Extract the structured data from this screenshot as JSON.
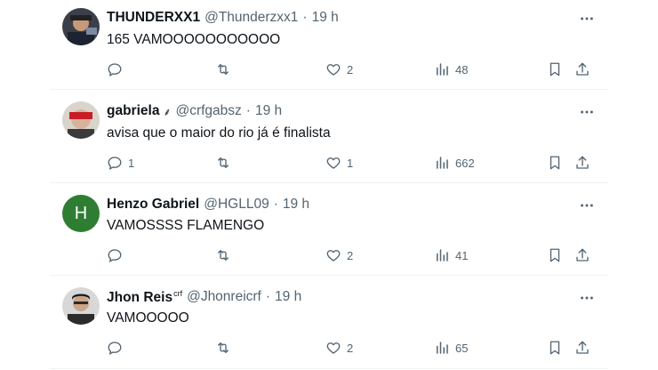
{
  "tweets": [
    {
      "name": "THUNDERXX1",
      "name_sup": "",
      "badge": "",
      "handle": "@Thunderzxx1",
      "time": "19 h",
      "text": "165 VAMOOOOOOOOOOO",
      "avatar": "photo",
      "replies": "",
      "retweets": "",
      "likes": "2",
      "views": "48"
    },
    {
      "name": "gabriela",
      "name_sup": "",
      "badge": "⸙",
      "handle": "@crfgabsz",
      "time": "19 h",
      "text": "avisa que o maior do rio já é finalista",
      "avatar": "photo",
      "replies": "1",
      "retweets": "",
      "likes": "1",
      "views": "662"
    },
    {
      "name": "Henzo Gabriel",
      "name_sup": "",
      "badge": "",
      "handle": "@HGLL09",
      "time": "19 h",
      "text": "VAMOSSSS FLAMENGO",
      "avatar": "H",
      "avatar_color": "#2e7d32",
      "replies": "",
      "retweets": "",
      "likes": "2",
      "views": "41"
    },
    {
      "name": "Jhon Reis",
      "name_sup": "crf",
      "badge": "",
      "handle": "@Jhonreicrf",
      "time": "19 h",
      "text": "VAMOOOOO",
      "avatar": "photo",
      "replies": "",
      "retweets": "",
      "likes": "2",
      "views": "65"
    }
  ],
  "icons": {
    "reply": "reply-icon",
    "retweet": "retweet-icon",
    "like": "heart-icon",
    "views": "views-icon",
    "bookmark": "bookmark-icon",
    "share": "share-icon",
    "more": "more-icon"
  },
  "colors": {
    "text": "#0f1419",
    "secondary": "#536471",
    "divider": "#eff3f4"
  }
}
